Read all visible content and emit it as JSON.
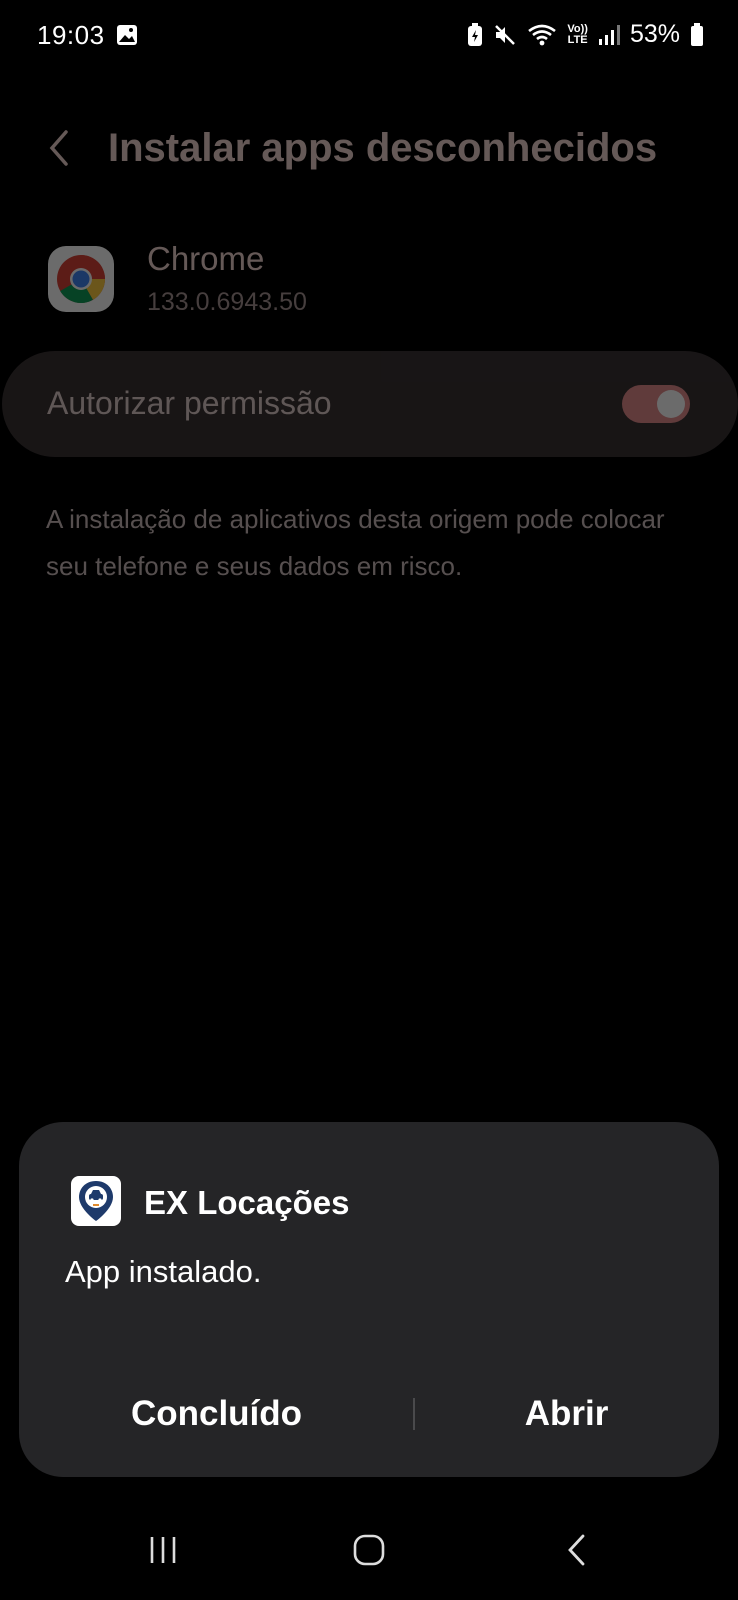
{
  "status_bar": {
    "time": "19:03",
    "battery_percent": "53%",
    "network_label": "LTE",
    "icons": [
      "gallery-icon",
      "battery-saver-icon",
      "mute-icon",
      "wifi-icon",
      "volte-icon",
      "signal-icon",
      "battery-icon"
    ]
  },
  "header": {
    "title": "Instalar apps desconhecidos",
    "back_icon": "chevron-left-icon"
  },
  "app_info": {
    "name": "Chrome",
    "version": "133.0.6943.50",
    "icon": "chrome-icon"
  },
  "permission": {
    "label": "Autorizar permissão",
    "enabled": true
  },
  "warning": {
    "text": "A instalação de aplicativos desta origem pode colocar seu telefone e seus dados em risco."
  },
  "dialog": {
    "app_name": "EX Locações",
    "app_icon": "ex-locacoes-icon",
    "message": "App instalado.",
    "done_label": "Concluído",
    "open_label": "Abrir"
  },
  "nav_bar": {
    "items": [
      "recent-apps-icon",
      "home-icon",
      "back-icon"
    ]
  },
  "colors": {
    "background": "#000000",
    "dialog_bg": "#252527",
    "toggle_on": "#e48c8e",
    "title_tint": "#f1d4d0"
  }
}
